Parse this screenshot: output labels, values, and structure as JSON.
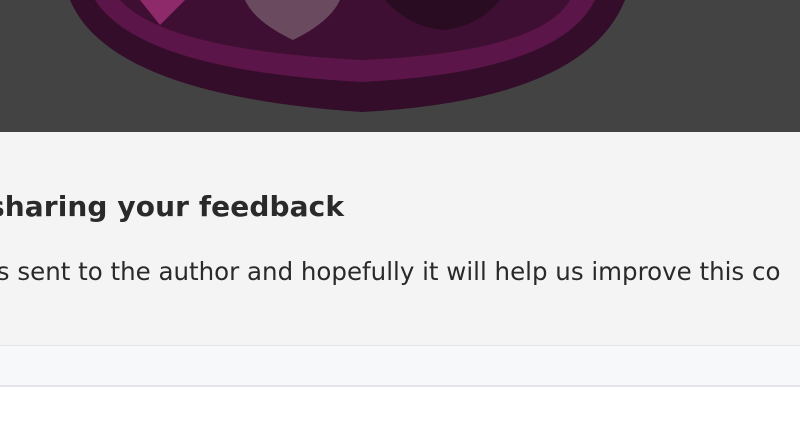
{
  "banner": {
    "image_icon": "badge-emblem-icon",
    "colors": {
      "overlay": "#434343",
      "emblem_dark": "#330d2a",
      "emblem_mid": "#5b1548",
      "emblem_light": "#8e2a6a"
    }
  },
  "feedback": {
    "heading": "sharing your feedback",
    "message": "is sent to the author and hopefully it will help us improve this co"
  }
}
